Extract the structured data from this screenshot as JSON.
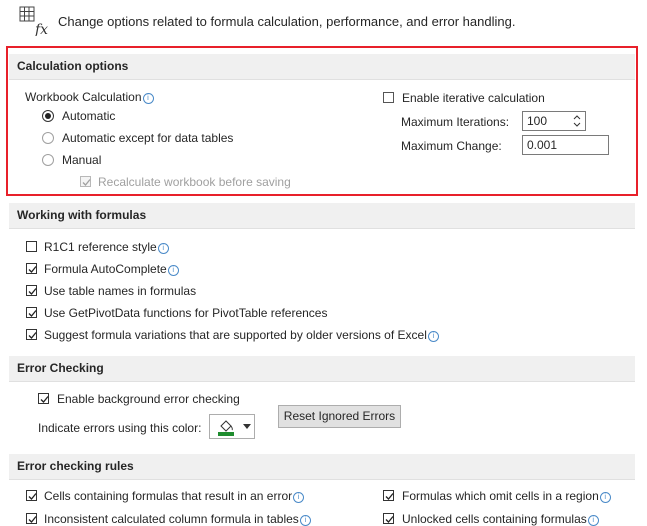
{
  "header": {
    "description": "Change options related to formula calculation, performance, and error handling."
  },
  "calc": {
    "section_title": "Calculation options",
    "workbook_label": "Workbook Calculation",
    "opt_automatic": "Automatic",
    "opt_auto_except": "Automatic except for data tables",
    "opt_manual": "Manual",
    "recalc_label": "Recalculate workbook before saving",
    "iterative_label": "Enable iterative calculation",
    "max_iter_label": "Maximum Iterations:",
    "max_iter_value": "100",
    "max_change_label": "Maximum Change:",
    "max_change_value": "0.001"
  },
  "formulas": {
    "section_title": "Working with formulas",
    "r1c1": "R1C1 reference style",
    "autocomplete": "Formula AutoComplete",
    "table_names": "Use table names in formulas",
    "getpivot": "Use GetPivotData functions for PivotTable references",
    "suggest": "Suggest formula variations that are supported by older versions of Excel"
  },
  "errors": {
    "section_title": "Error Checking",
    "enable_bg": "Enable background error checking",
    "indicate_label": "Indicate errors using this color:",
    "reset_button": "Reset Ignored Errors"
  },
  "rules": {
    "section_title": "Error checking rules",
    "cells_formulas": "Cells containing formulas that result in an error",
    "inconsistent": "Inconsistent calculated column formula in tables",
    "omit_cells": "Formulas which omit cells in a region",
    "unlocked": "Unlocked cells containing formulas"
  },
  "colors": {
    "accent_red": "#e8202a",
    "error_indicator_green": "#1e8c2e"
  }
}
